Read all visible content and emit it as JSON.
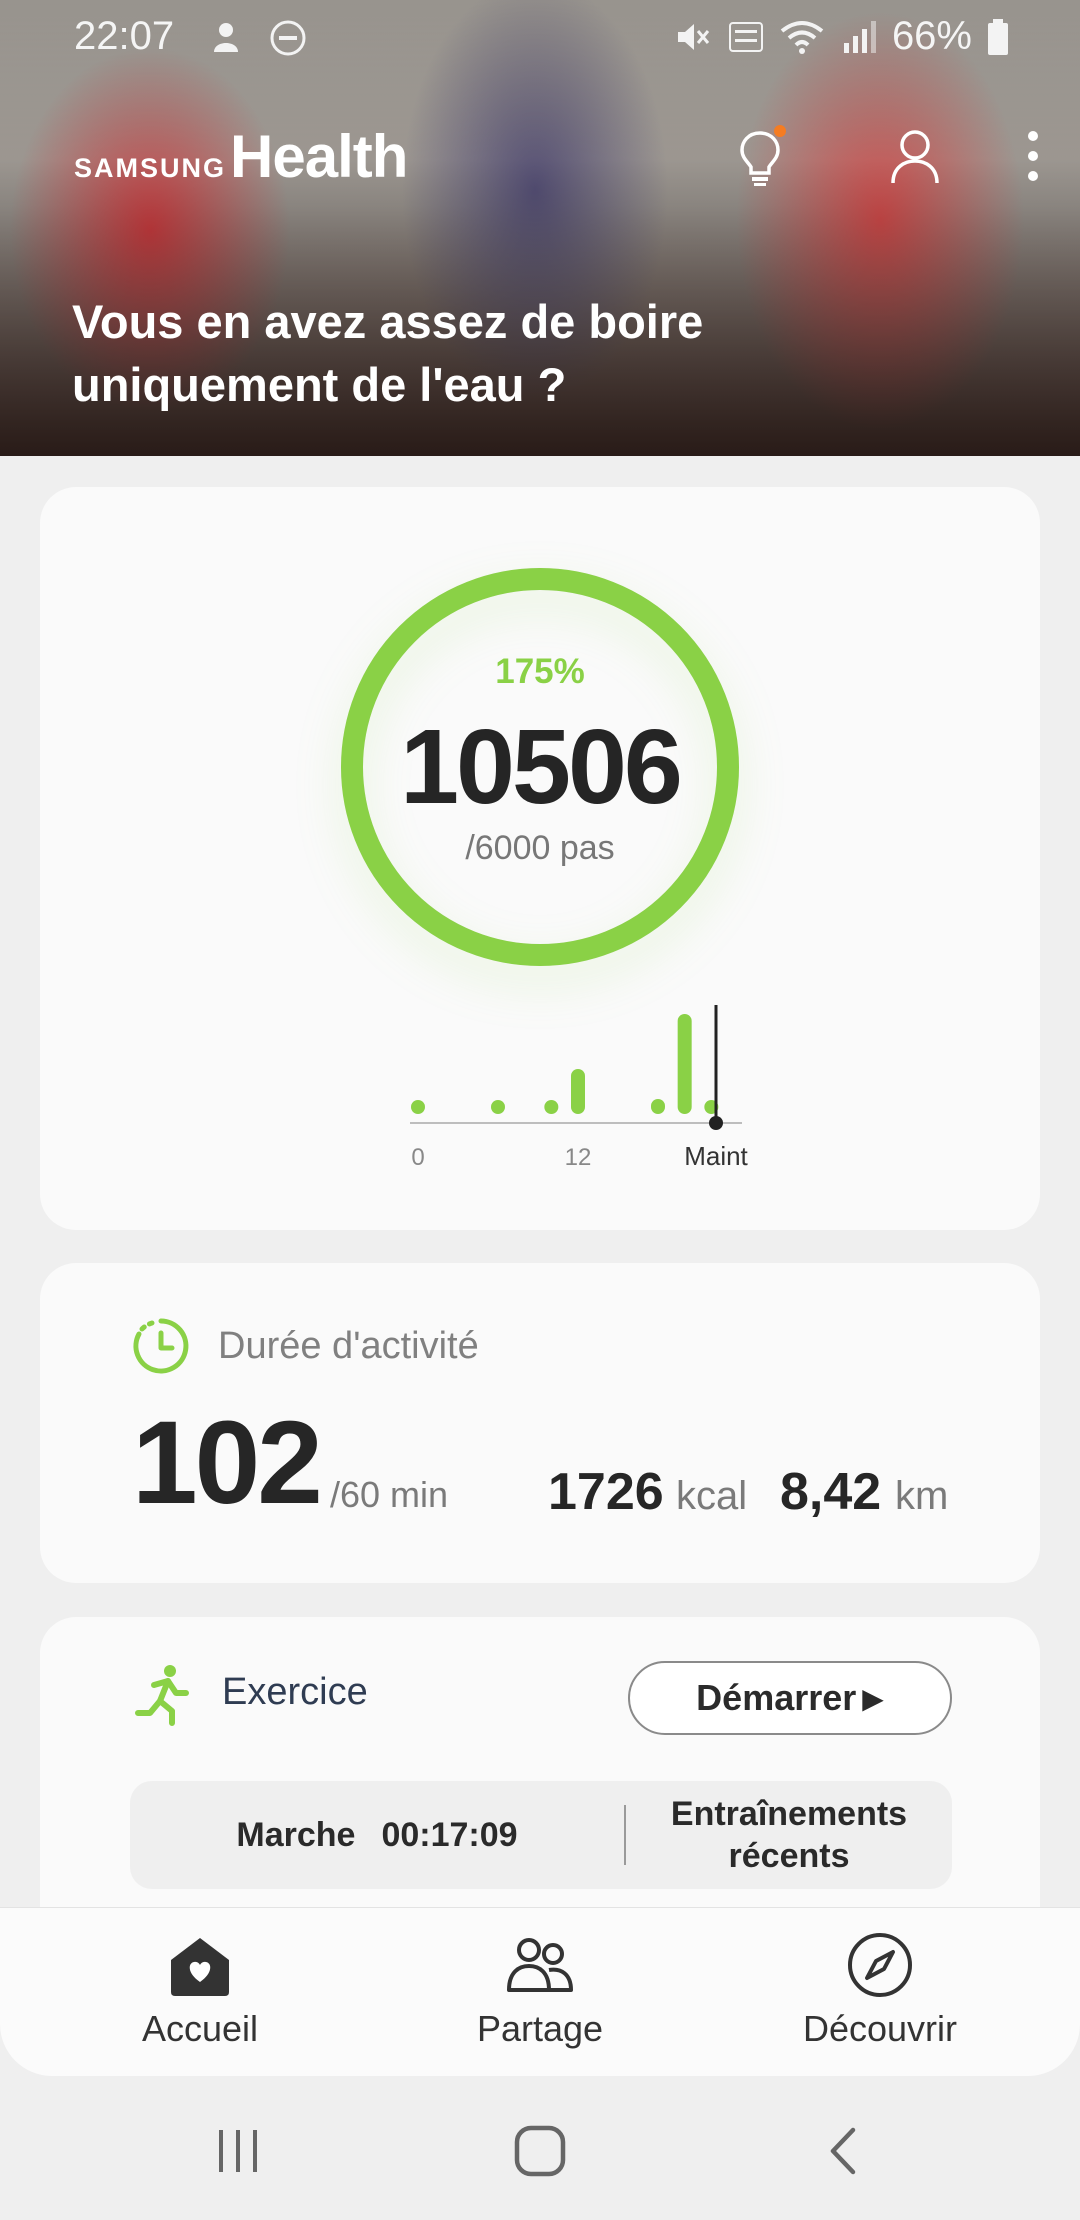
{
  "status_bar": {
    "time": "22:07",
    "battery": "66%"
  },
  "header": {
    "brand_samsung": "SAMSUNG",
    "brand_health": "Health",
    "icons": [
      "lightbulb-icon",
      "profile-icon",
      "more-vert-icon"
    ],
    "banner_title": "Vous en avez assez de boire uniquement de l'eau ?"
  },
  "steps": {
    "percent": "175%",
    "value": "10506",
    "goal": "/6000 pas",
    "progress_fraction": 1.0,
    "ring_color": "#8ad146",
    "chart_axis": {
      "label_start": "0",
      "label_mid": "12",
      "label_now": "Maint"
    }
  },
  "chart_data": {
    "type": "bar",
    "x": [
      0,
      3,
      5,
      6,
      9,
      10,
      11
    ],
    "values": [
      0.1,
      0.1,
      0.1,
      0.45,
      0.15,
      1.0,
      0.1
    ],
    "xlim": [
      0,
      12
    ]
  },
  "activity": {
    "title": "Durée d'activité",
    "minutes": "102",
    "goal": "/60 min",
    "kcal_value": "1726",
    "kcal_unit": "kcal",
    "km_value": "8,42",
    "km_unit": "km",
    "accent": "#8ad146"
  },
  "exercise": {
    "title": "Exercice",
    "start_label": "Démarrer",
    "last_activity": "Marche",
    "last_duration": "00:17:09",
    "recent_label": "Entraînements récents"
  },
  "bottom_nav": {
    "home": "Accueil",
    "share": "Partage",
    "discover": "Découvrir"
  }
}
